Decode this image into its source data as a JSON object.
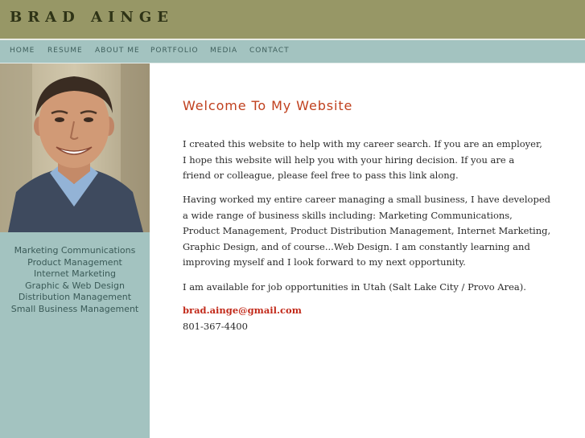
{
  "header": {
    "title": "BRAD AINGE"
  },
  "nav": [
    "HOME",
    "RESUME",
    "ABOUT ME",
    "PORTFOLIO",
    "MEDIA",
    "CONTACT"
  ],
  "sidebar": {
    "photo": "portrait-photo",
    "skills": [
      "Marketing Communications",
      "Product Management",
      "Internet Marketing",
      "Graphic & Web Design",
      "Distribution Management",
      "Small Business Management"
    ]
  },
  "main": {
    "heading": "Welcome To My Website",
    "paragraph1": [
      "I created this website to help with my career search.  If you are an employer,",
      "I hope this website will help you with your hiring decision.  If you are a",
      "friend or colleague, please feel free to pass this link along."
    ],
    "paragraph2": [
      "Having worked my entire career managing a small business, I have developed",
      "a wide range of business skills including: Marketing Communications,",
      "Product Management, Product Distribution Management, Internet Marketing,",
      "Graphic Design, and of course...Web Design.  I am constantly learning and",
      "improving myself and I look forward to my next opportunity."
    ],
    "paragraph3": [
      "I am available for job opportunities in Utah (Salt Lake City / Provo Area)."
    ],
    "email": "brad.ainge@gmail.com",
    "phone": "801-367-4400"
  },
  "colors": {
    "header": "#979766",
    "nav": "#a3c3c0",
    "heading": "#c0401e",
    "email": "#c22a1a"
  }
}
